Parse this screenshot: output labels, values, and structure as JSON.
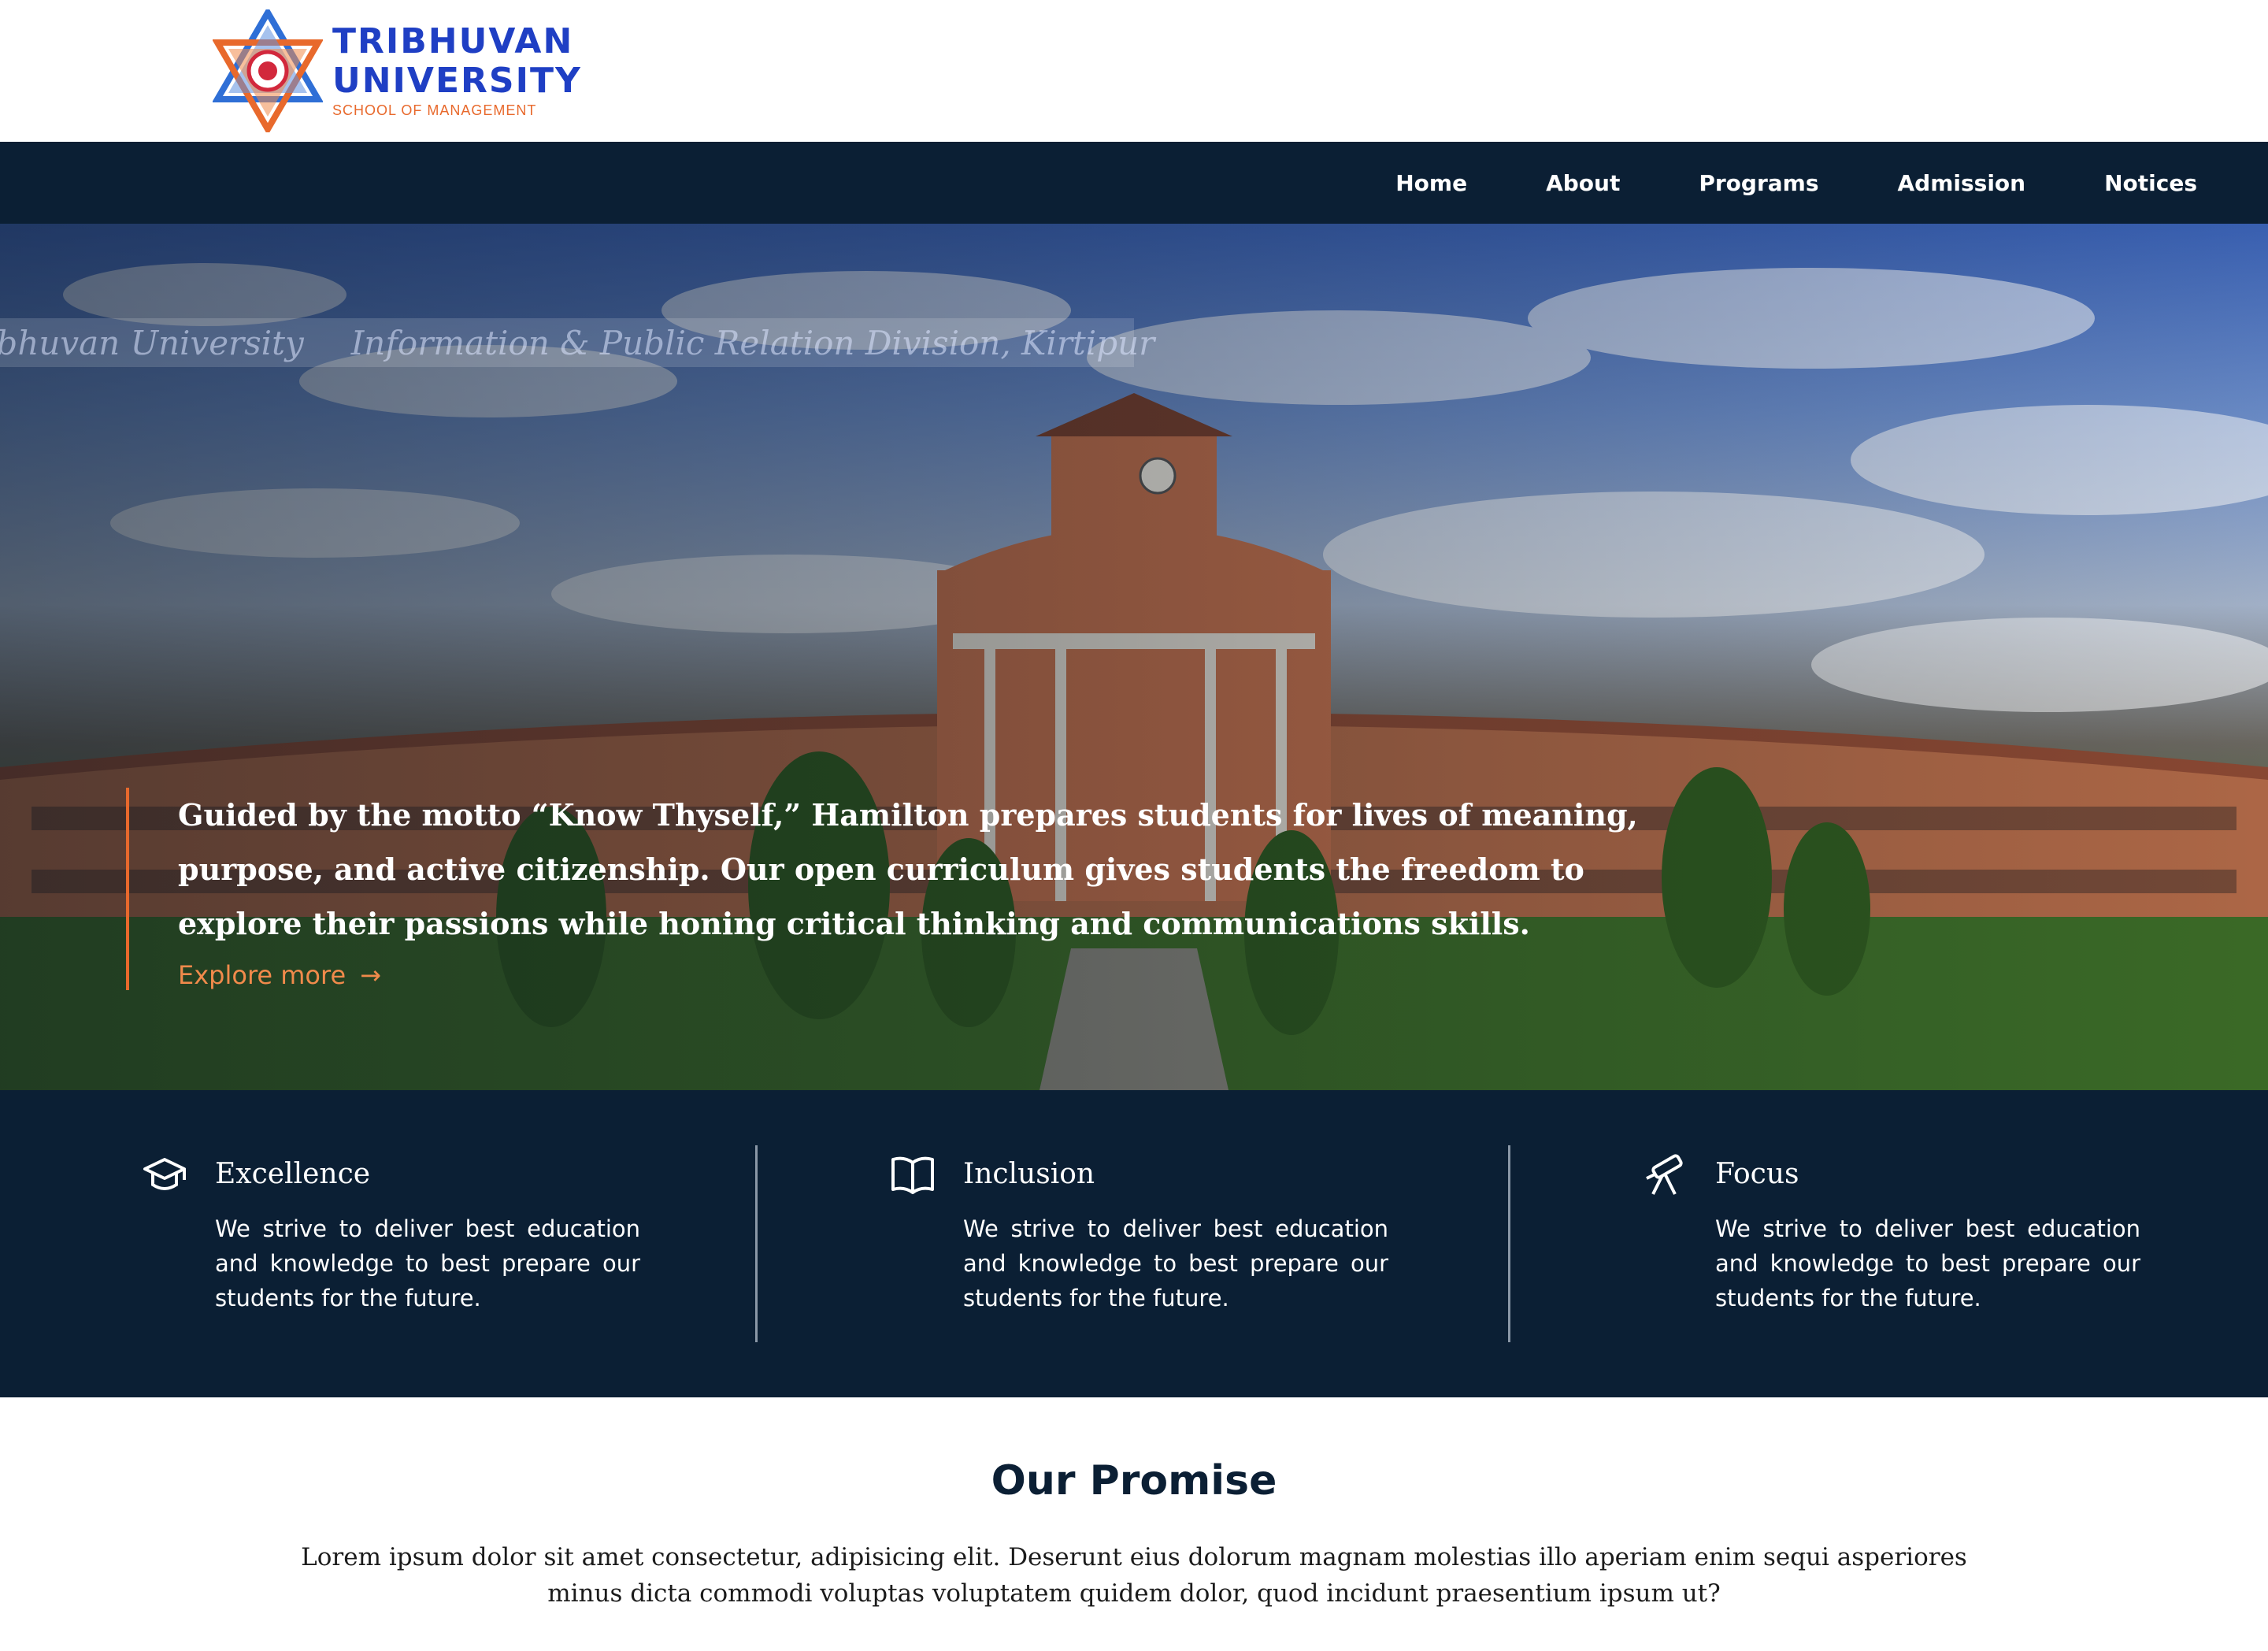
{
  "header": {
    "logo": {
      "line1": "TRIBHUVAN",
      "line2": "UNIVERSITY",
      "line3": "SCHOOL OF MANAGEMENT"
    }
  },
  "nav": {
    "items": [
      {
        "label": "Home"
      },
      {
        "label": "About"
      },
      {
        "label": "Programs"
      },
      {
        "label": "Admission"
      },
      {
        "label": "Notices"
      }
    ]
  },
  "hero": {
    "watermark_left": "ibhuvan University",
    "watermark_right": "Information & Public Relation Division, Kirtipur",
    "text": "Guided by the motto “Know Thyself,” Hamilton prepares students for lives of meaning, purpose, and active citizenship. Our open curriculum gives students the freedom to explore their passions while honing critical thinking and communications skills.",
    "link_label": "Explore more",
    "link_icon": "arrow-right-icon"
  },
  "values": [
    {
      "icon": "graduation-cap-icon",
      "title": "Excellence",
      "description": "We strive to deliver best education and knowledge to best prepare our students for the future."
    },
    {
      "icon": "open-book-icon",
      "title": "Inclusion",
      "description": "We strive to deliver best education and knowledge to best prepare our students for the future."
    },
    {
      "icon": "telescope-icon",
      "title": "Focus",
      "description": "We strive to deliver best education and knowledge to best prepare our students for the future."
    }
  ],
  "promise": {
    "title": "Our Promise",
    "text": "Lorem ipsum dolor sit amet consectetur, adipisicing elit. Deserunt eius dolorum magnam molestias illo aperiam enim sequi asperiores minus dicta commodi voluptas voluptatem quidem dolor, quod incidunt praesentium ipsum ut?"
  },
  "colors": {
    "navy": "#0b1f34",
    "accent": "#e8692c",
    "brand_blue": "#1f3fc4"
  }
}
